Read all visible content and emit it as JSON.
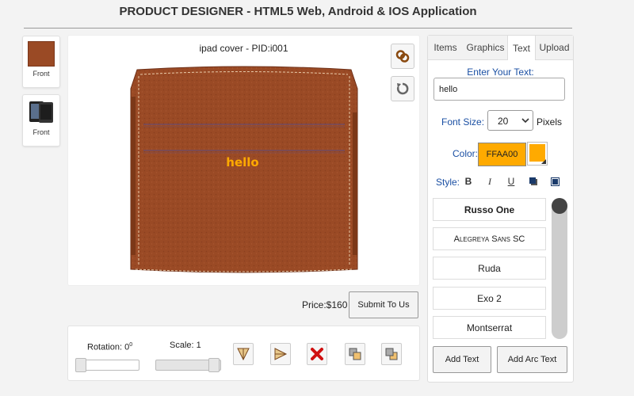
{
  "page": {
    "title": "PRODUCT DESIGNER - HTML5 Web, Android & IOS Application"
  },
  "thumbnails": [
    {
      "caption": "Front",
      "image": "leather-cover-thumbnail"
    },
    {
      "caption": "Front",
      "image": "ipad-thumbnail"
    }
  ],
  "canvas": {
    "product_title": "ipad cover - PID:i001",
    "design_text": "hello",
    "design_text_color": "#FFAA00",
    "cover_color": "#9a4a25",
    "tools": {
      "link_icon": "link-icon",
      "reset_icon": "rotate-reset-icon"
    }
  },
  "footer": {
    "price": "Price:$160",
    "submit_label": "Submit To Us"
  },
  "controls": {
    "rotation_label": "Rotation: 0",
    "rotation_degree": "0",
    "rotation_value": 0,
    "scale_label": "Scale: 1",
    "scale_value": 1,
    "icons": [
      "flip-vertical-icon",
      "flip-horizontal-icon",
      "delete-icon",
      "bring-forward-icon",
      "send-backward-icon"
    ]
  },
  "panel": {
    "tabs": [
      {
        "label": "Items"
      },
      {
        "label": "Graphics"
      },
      {
        "label": "Text",
        "active": true
      },
      {
        "label": "Upload"
      }
    ],
    "enter_text_label": "Enter Your Text:",
    "text_value": "hello",
    "font_size_label": "Font Size:",
    "font_size_value": "20",
    "pixels_label": "Pixels",
    "color_label": "Color:",
    "color_value": "FFAA00",
    "style_label": "Style:",
    "style_buttons": [
      "B",
      "I",
      "U"
    ],
    "fonts": [
      "Russo One",
      "Alegreya Sans SC",
      "Ruda",
      "Exo 2",
      "Montserrat"
    ],
    "add_text_label": "Add Text",
    "add_arc_text_label": "Add Arc Text"
  }
}
